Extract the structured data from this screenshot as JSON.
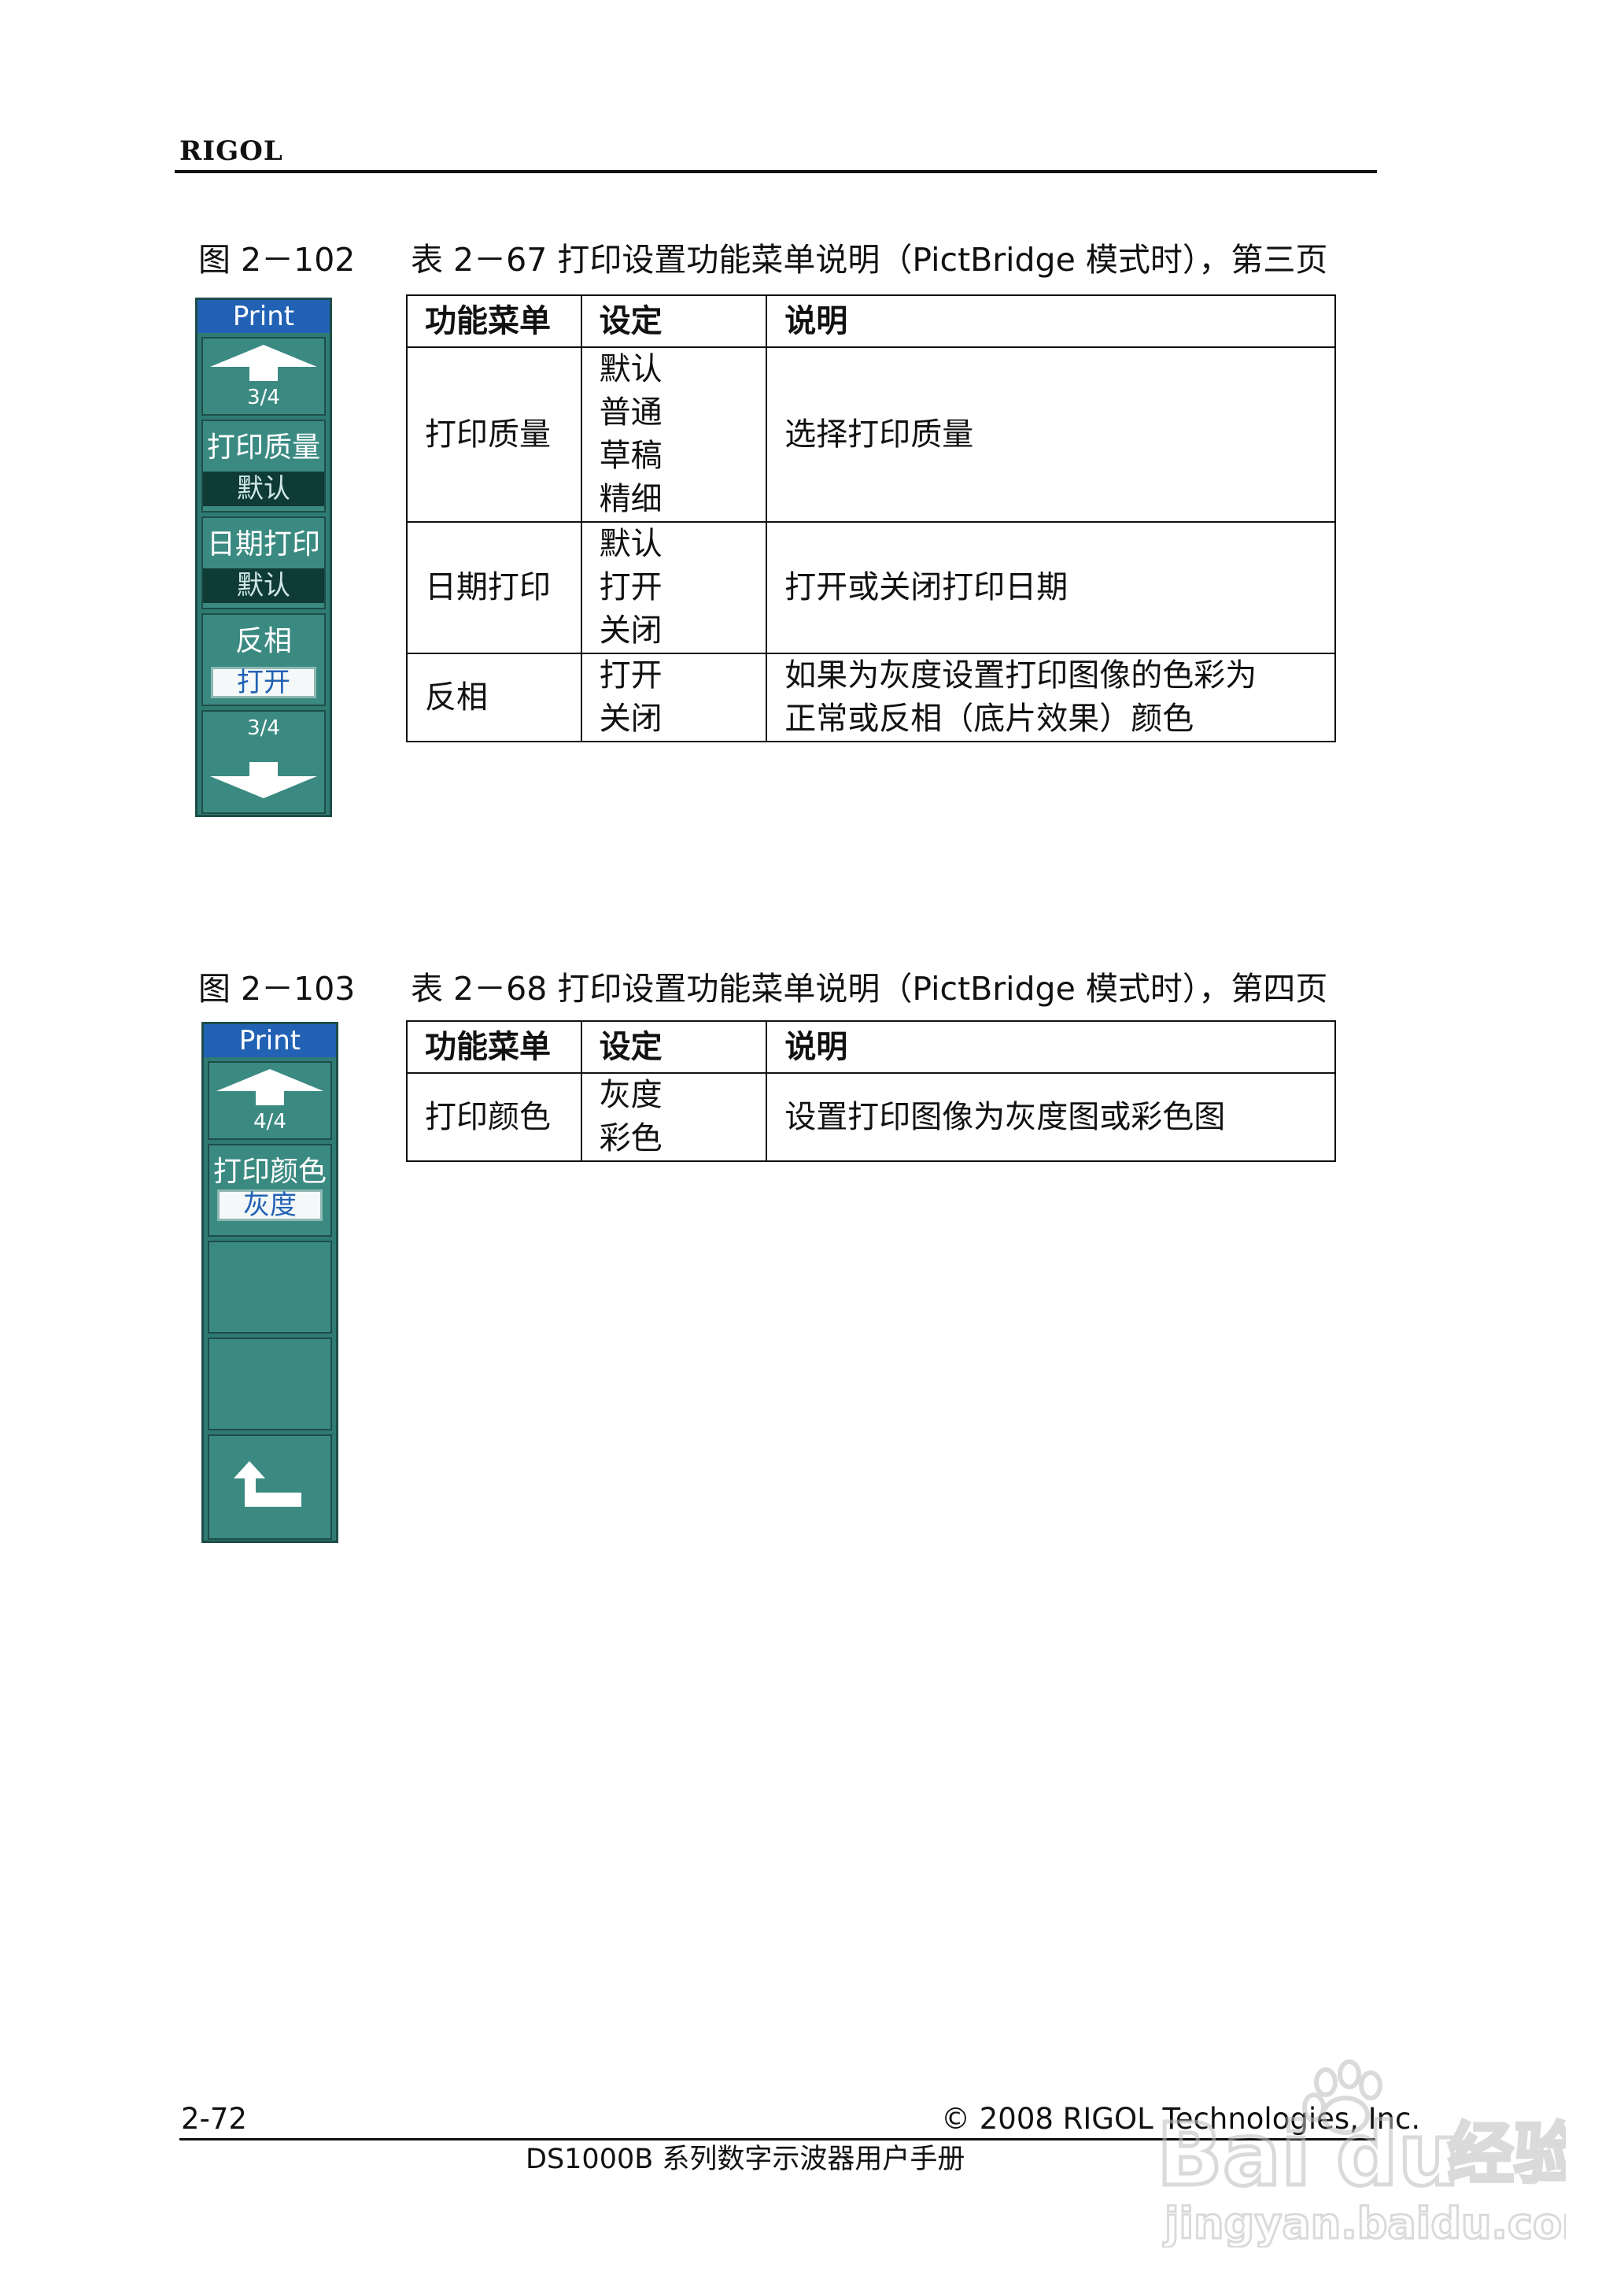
{
  "header": {
    "brand": "RIGOL"
  },
  "section1": {
    "figure_caption": "图 2－102",
    "table_caption": "表 2－67  打印设置功能菜单说明（PictBridge 模式时），第三页",
    "menu": {
      "title": "Print",
      "page_top": "3/4",
      "page_bottom": "3/4",
      "items": [
        {
          "label": "打印质量",
          "value": "默认"
        },
        {
          "label": "日期打印",
          "value": "默认"
        },
        {
          "label": "反相",
          "value": "打开"
        }
      ]
    },
    "table": {
      "headers": [
        "功能菜单",
        "设定",
        "说明"
      ],
      "rows": [
        {
          "menu": "打印质量",
          "settings": [
            "默认",
            "普通",
            "草稿",
            "精细"
          ],
          "desc": [
            "选择打印质量"
          ]
        },
        {
          "menu": "日期打印",
          "settings": [
            "默认",
            "打开",
            "关闭"
          ],
          "desc": [
            "打开或关闭打印日期"
          ]
        },
        {
          "menu": "反相",
          "settings": [
            "打开",
            "关闭"
          ],
          "desc": [
            "如果为灰度设置打印图像的色彩为",
            "正常或反相（底片效果）颜色"
          ]
        }
      ]
    }
  },
  "section2": {
    "figure_caption": "图 2－103",
    "table_caption": "表 2－68  打印设置功能菜单说明（PictBridge 模式时），第四页",
    "menu": {
      "title": "Print",
      "page_top": "4/4",
      "items": [
        {
          "label": "打印颜色",
          "value": "灰度"
        }
      ]
    },
    "table": {
      "headers": [
        "功能菜单",
        "设定",
        "说明"
      ],
      "rows": [
        {
          "menu": "打印颜色",
          "settings": [
            "灰度",
            "彩色"
          ],
          "desc": [
            "设置打印图像为灰度图或彩色图"
          ]
        }
      ]
    }
  },
  "footer": {
    "page_number": "2-72",
    "copyright": "© 2008 RIGOL Technologies, Inc.",
    "title": "DS1000B 系列数字示波器用户手册"
  },
  "watermark": {
    "text": "Bai du 经验",
    "url_text": "jingyan.baidu.com"
  },
  "colors": {
    "menu_bg": "#2f7b73",
    "menu_title_bg": "#2262b5",
    "menu_value_dark": "#0f3b37",
    "menu_value_light_text": "#2262b5"
  }
}
